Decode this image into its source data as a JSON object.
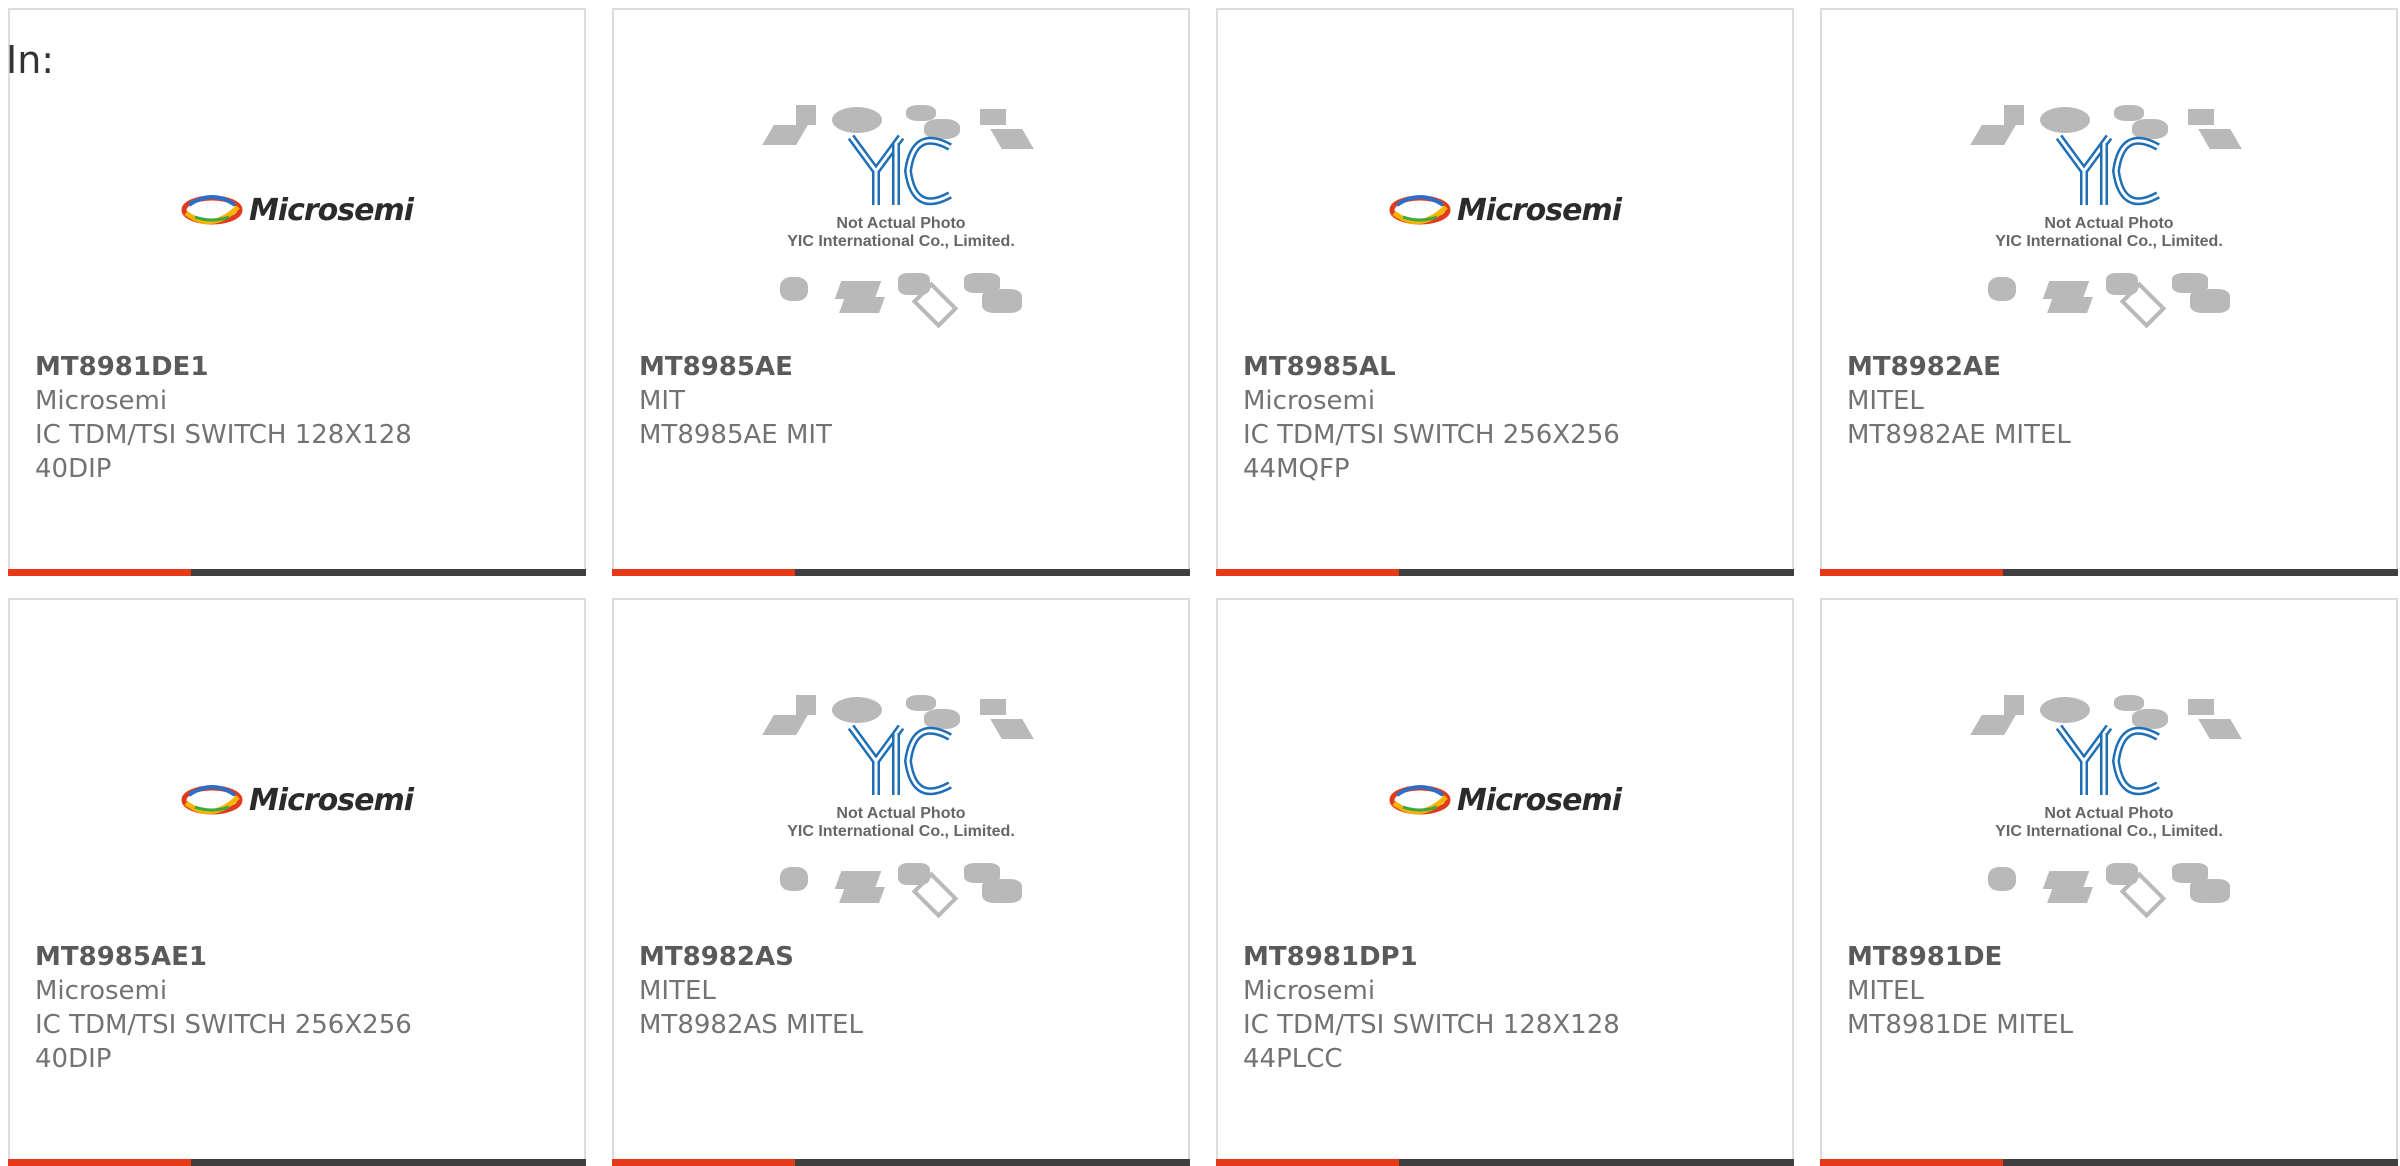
{
  "prefix": "In:",
  "colors": {
    "accent_bar": "#e5391a",
    "dark_bar": "#3f3f3f",
    "border": "#dcdcdc"
  },
  "yic_caption": [
    "Not Actual Photo",
    "YIC International Co., Limited."
  ],
  "logo_text": "Microsemi",
  "products": [
    {
      "part": "MT8981DE1",
      "brand": "Microsemi",
      "lines": [
        "IC TDM/TSI SWITCH 128X128",
        "40DIP"
      ],
      "image": "microsemi-logo"
    },
    {
      "part": "MT8985AE",
      "brand": "MIT",
      "lines": [
        "MT8985AE MIT"
      ],
      "image": "yic-placeholder"
    },
    {
      "part": "MT8985AL",
      "brand": "Microsemi",
      "lines": [
        "IC TDM/TSI SWITCH 256X256",
        "44MQFP"
      ],
      "image": "microsemi-logo"
    },
    {
      "part": "MT8982AE",
      "brand": "MITEL",
      "lines": [
        "MT8982AE MITEL"
      ],
      "image": "yic-placeholder"
    },
    {
      "part": "MT8985AE1",
      "brand": "Microsemi",
      "lines": [
        "IC TDM/TSI SWITCH 256X256",
        "40DIP"
      ],
      "image": "microsemi-logo"
    },
    {
      "part": "MT8982AS",
      "brand": "MITEL",
      "lines": [
        "MT8982AS MITEL"
      ],
      "image": "yic-placeholder"
    },
    {
      "part": "MT8981DP1",
      "brand": "Microsemi",
      "lines": [
        "IC TDM/TSI SWITCH 128X128",
        "44PLCC"
      ],
      "image": "microsemi-logo"
    },
    {
      "part": "MT8981DE",
      "brand": "MITEL",
      "lines": [
        "MT8981DE MITEL"
      ],
      "image": "yic-placeholder"
    }
  ]
}
